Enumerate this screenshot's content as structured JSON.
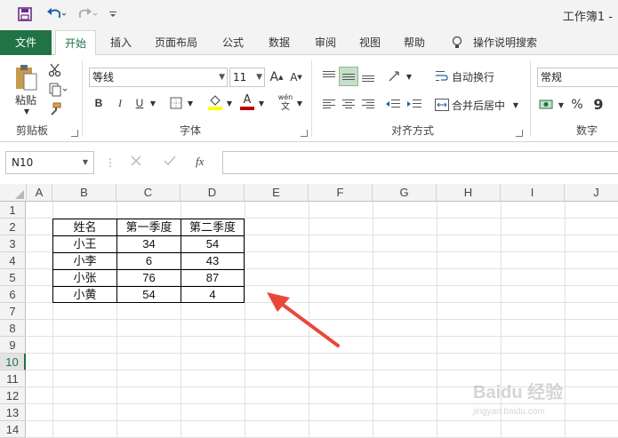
{
  "title_bar": {
    "doc_title": "工作簿1 -"
  },
  "tabs": [
    "文件",
    "开始",
    "插入",
    "页面布局",
    "公式",
    "数据",
    "审阅",
    "视图",
    "帮助"
  ],
  "tell_me": "操作说明搜索",
  "ribbon": {
    "clipboard": {
      "paste": "粘贴",
      "label": "剪贴板"
    },
    "font": {
      "name": "等线",
      "size": "11",
      "grow": "A",
      "shrink": "A",
      "bold": "B",
      "italic": "I",
      "underline": "U",
      "font_color_letter": "A",
      "phonetic": "wén",
      "phonetic_char": "文",
      "label": "字体"
    },
    "alignment": {
      "wrap": "自动换行",
      "merge": "合并后居中",
      "label": "对齐方式"
    },
    "number": {
      "format": "常规",
      "percent": "%",
      "comma": "9",
      "label": "数字"
    }
  },
  "formula_bar": {
    "name_box": "N10",
    "fx": "fx",
    "value": ""
  },
  "columns": [
    "A",
    "B",
    "C",
    "D",
    "E",
    "F",
    "G",
    "H",
    "I",
    "J"
  ],
  "rows": [
    "1",
    "2",
    "3",
    "4",
    "5",
    "6",
    "7",
    "8",
    "9",
    "10",
    "11",
    "12",
    "13",
    "14"
  ],
  "selected_row": "10",
  "table": {
    "header": [
      "姓名",
      "第一季度",
      "第二季度"
    ],
    "rows": [
      [
        "小王",
        "34",
        "54"
      ],
      [
        "小李",
        "6",
        "43"
      ],
      [
        "小张",
        "76",
        "87"
      ],
      [
        "小黄",
        "54",
        "4"
      ]
    ]
  },
  "watermark": {
    "text": "Baidu 经验",
    "sub": "jingyan.baidu.com"
  },
  "colors": {
    "accent": "#217346",
    "arrow": "#e8483a",
    "font_color_bar": "#c00000",
    "highlight_bar": "#ffff00"
  }
}
